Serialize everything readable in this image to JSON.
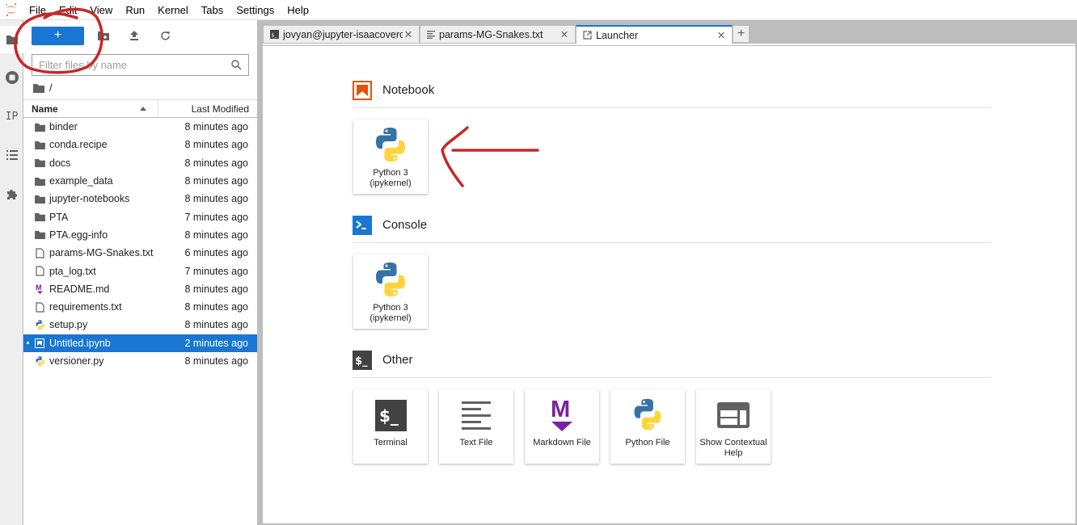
{
  "menubar": {
    "items": [
      "File",
      "Edit",
      "View",
      "Run",
      "Kernel",
      "Tabs",
      "Settings",
      "Help"
    ]
  },
  "leftbar": {
    "items": [
      {
        "name": "file-browser",
        "icon": "folder-icon",
        "active": true
      },
      {
        "name": "running-sessions",
        "icon": "stop-circle-icon"
      },
      {
        "name": "property-inspector",
        "icon": "property-inspector-icon",
        "text": "IP"
      },
      {
        "name": "table-of-contents",
        "icon": "list-icon"
      },
      {
        "name": "extension-manager",
        "icon": "puzzle-icon"
      }
    ]
  },
  "filebrowser": {
    "new_button_label": "+",
    "filter_placeholder": "Filter files by name",
    "filter_value": "",
    "breadcrumb": "/",
    "columns": {
      "name": "Name",
      "modified": "Last Modified"
    },
    "files": [
      {
        "name": "binder",
        "type": "folder",
        "modified": "8 minutes ago"
      },
      {
        "name": "conda.recipe",
        "type": "folder",
        "modified": "8 minutes ago"
      },
      {
        "name": "docs",
        "type": "folder",
        "modified": "8 minutes ago"
      },
      {
        "name": "example_data",
        "type": "folder",
        "modified": "8 minutes ago"
      },
      {
        "name": "jupyter-notebooks",
        "type": "folder",
        "modified": "8 minutes ago"
      },
      {
        "name": "PTA",
        "type": "folder",
        "modified": "7 minutes ago"
      },
      {
        "name": "PTA.egg-info",
        "type": "folder",
        "modified": "8 minutes ago"
      },
      {
        "name": "params-MG-Snakes.txt",
        "type": "file",
        "modified": "6 minutes ago"
      },
      {
        "name": "pta_log.txt",
        "type": "file",
        "modified": "7 minutes ago"
      },
      {
        "name": "README.md",
        "type": "markdown",
        "modified": "8 minutes ago"
      },
      {
        "name": "requirements.txt",
        "type": "file",
        "modified": "8 minutes ago"
      },
      {
        "name": "setup.py",
        "type": "python",
        "modified": "8 minutes ago"
      },
      {
        "name": "Untitled.ipynb",
        "type": "notebook",
        "modified": "2 minutes ago",
        "selected": true
      },
      {
        "name": "versioner.py",
        "type": "python",
        "modified": "8 minutes ago"
      }
    ]
  },
  "tabs": [
    {
      "label": "jovyan@jupyter-isaacoverca",
      "icon": "terminal-icon"
    },
    {
      "label": "params-MG-Snakes.txt",
      "icon": "text-file-icon"
    },
    {
      "label": "Launcher",
      "icon": "launcher-icon",
      "active": true
    }
  ],
  "launcher": {
    "sections": [
      {
        "title": "Notebook",
        "icon": "notebook-icon",
        "cards": [
          {
            "label": "Python 3 (ipykernel)",
            "icon": "python-icon"
          }
        ]
      },
      {
        "title": "Console",
        "icon": "console-icon",
        "cards": [
          {
            "label": "Python 3 (ipykernel)",
            "icon": "python-icon"
          }
        ]
      },
      {
        "title": "Other",
        "icon": "terminal-icon",
        "cards": [
          {
            "label": "Terminal",
            "icon": "terminal-icon"
          },
          {
            "label": "Text File",
            "icon": "text-file-icon"
          },
          {
            "label": "Markdown File",
            "icon": "markdown-icon"
          },
          {
            "label": "Python File",
            "icon": "python-icon"
          },
          {
            "label": "Show Contextual Help",
            "icon": "contextual-help-icon"
          }
        ]
      }
    ]
  },
  "colors": {
    "accent": "#1976d2",
    "notebook": "#e65100",
    "markdown": "#7b1fa2",
    "annotation": "#c62828"
  }
}
